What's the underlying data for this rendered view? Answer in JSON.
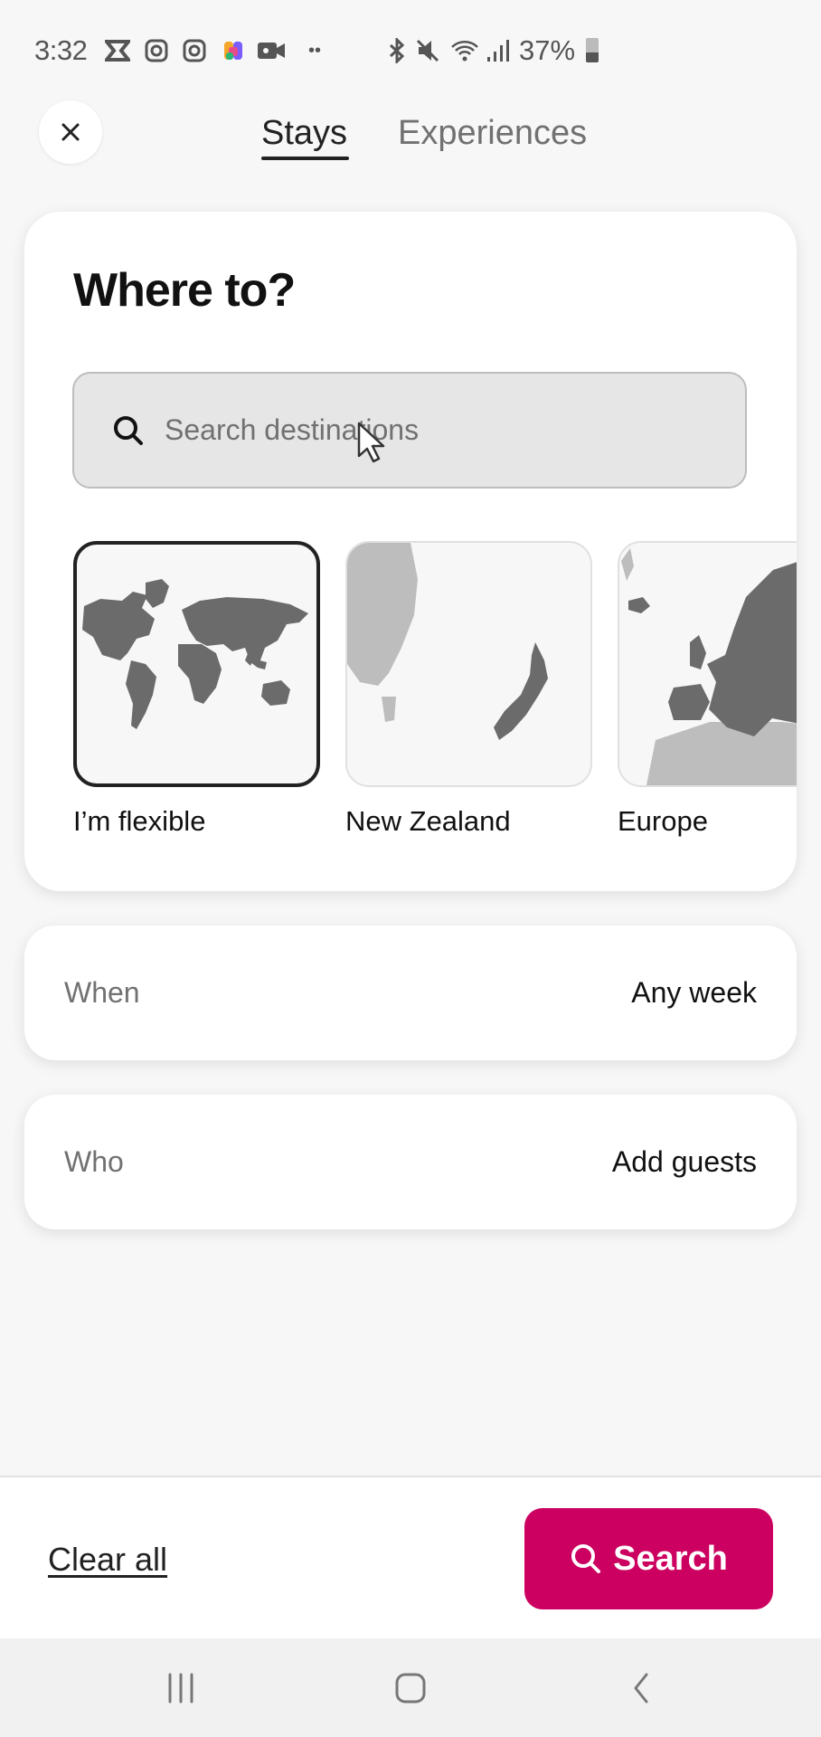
{
  "status_bar": {
    "time": "3:32",
    "left_icons": [
      "capcut-icon",
      "instagram-icon",
      "instagram-icon",
      "copilot-icon",
      "video-camera-icon",
      "more-dots-icon"
    ],
    "right_icons": [
      "bluetooth-icon",
      "mute-icon",
      "wifi-icon",
      "signal-icon"
    ],
    "battery": "37%"
  },
  "header": {
    "close_icon": "close-icon",
    "tabs": [
      {
        "label": "Stays",
        "active": true
      },
      {
        "label": "Experiences",
        "active": false
      }
    ]
  },
  "where": {
    "title": "Where to?",
    "search_placeholder": "Search destinations",
    "regions": [
      {
        "label": "I’m flexible",
        "selected": true
      },
      {
        "label": "New Zealand",
        "selected": false
      },
      {
        "label": "Europe",
        "selected": false
      }
    ]
  },
  "when": {
    "label": "When",
    "value": "Any week"
  },
  "who": {
    "label": "Who",
    "value": "Add guests"
  },
  "footer": {
    "clear_label": "Clear all",
    "search_label": "Search",
    "accent_color": "#cc0060"
  },
  "nav_bar": {
    "buttons": [
      "recent-apps-icon",
      "home-icon",
      "back-icon"
    ]
  }
}
